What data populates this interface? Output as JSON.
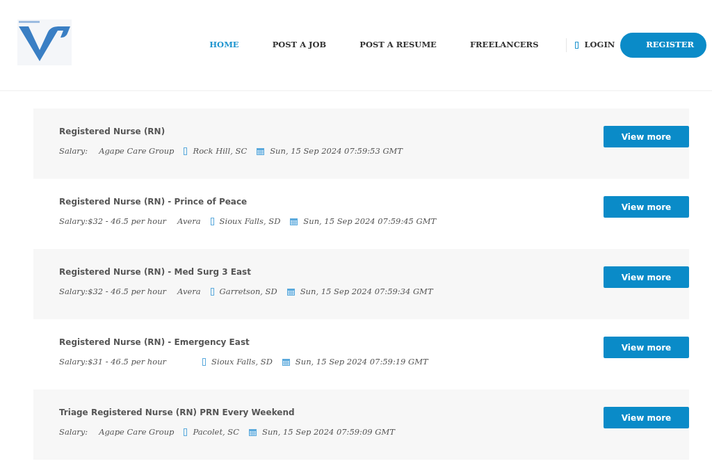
{
  "nav": {
    "items": [
      {
        "label": "HOME",
        "selected": true
      },
      {
        "label": "POST A JOB",
        "selected": false
      },
      {
        "label": "POST A RESUME",
        "selected": false
      },
      {
        "label": "FREELANCERS",
        "selected": false
      }
    ],
    "login": "LOGIN",
    "register": "REGISTER"
  },
  "jobs": [
    {
      "title": "Registered Nurse (RN)",
      "salary": "Salary:",
      "employer": "Agape Care Group",
      "location": "Rock Hill, SC",
      "date": "Sun, 15 Sep 2024 07:59:53 GMT",
      "button": "View more"
    },
    {
      "title": "Registered Nurse (RN) - Prince of Peace",
      "salary": "Salary:$32 - 46.5 per hour",
      "employer": "Avera",
      "location": "Sioux Falls, SD",
      "date": "Sun, 15 Sep 2024 07:59:45 GMT",
      "button": "View more"
    },
    {
      "title": "Registered Nurse (RN) - Med Surg 3 East",
      "salary": "Salary:$32 - 46.5 per hour",
      "employer": "Avera",
      "location": "Garretson, SD",
      "date": "Sun, 15 Sep 2024 07:59:34 GMT",
      "button": "View more"
    },
    {
      "title": "Registered Nurse (RN) - Emergency East",
      "salary": "Salary:$31 - 46.5 per hour",
      "location": "Sioux Falls, SD",
      "date": "Sun, 15 Sep 2024 07:59:19 GMT",
      "button": "View more"
    },
    {
      "title": "Triage Registered Nurse (RN) PRN Every Weekend",
      "salary": "Salary:",
      "employer": "Agape Care Group",
      "location": "Pacolet, SC",
      "date": "Sun, 15 Sep 2024 07:59:09 GMT",
      "button": "View more"
    }
  ]
}
